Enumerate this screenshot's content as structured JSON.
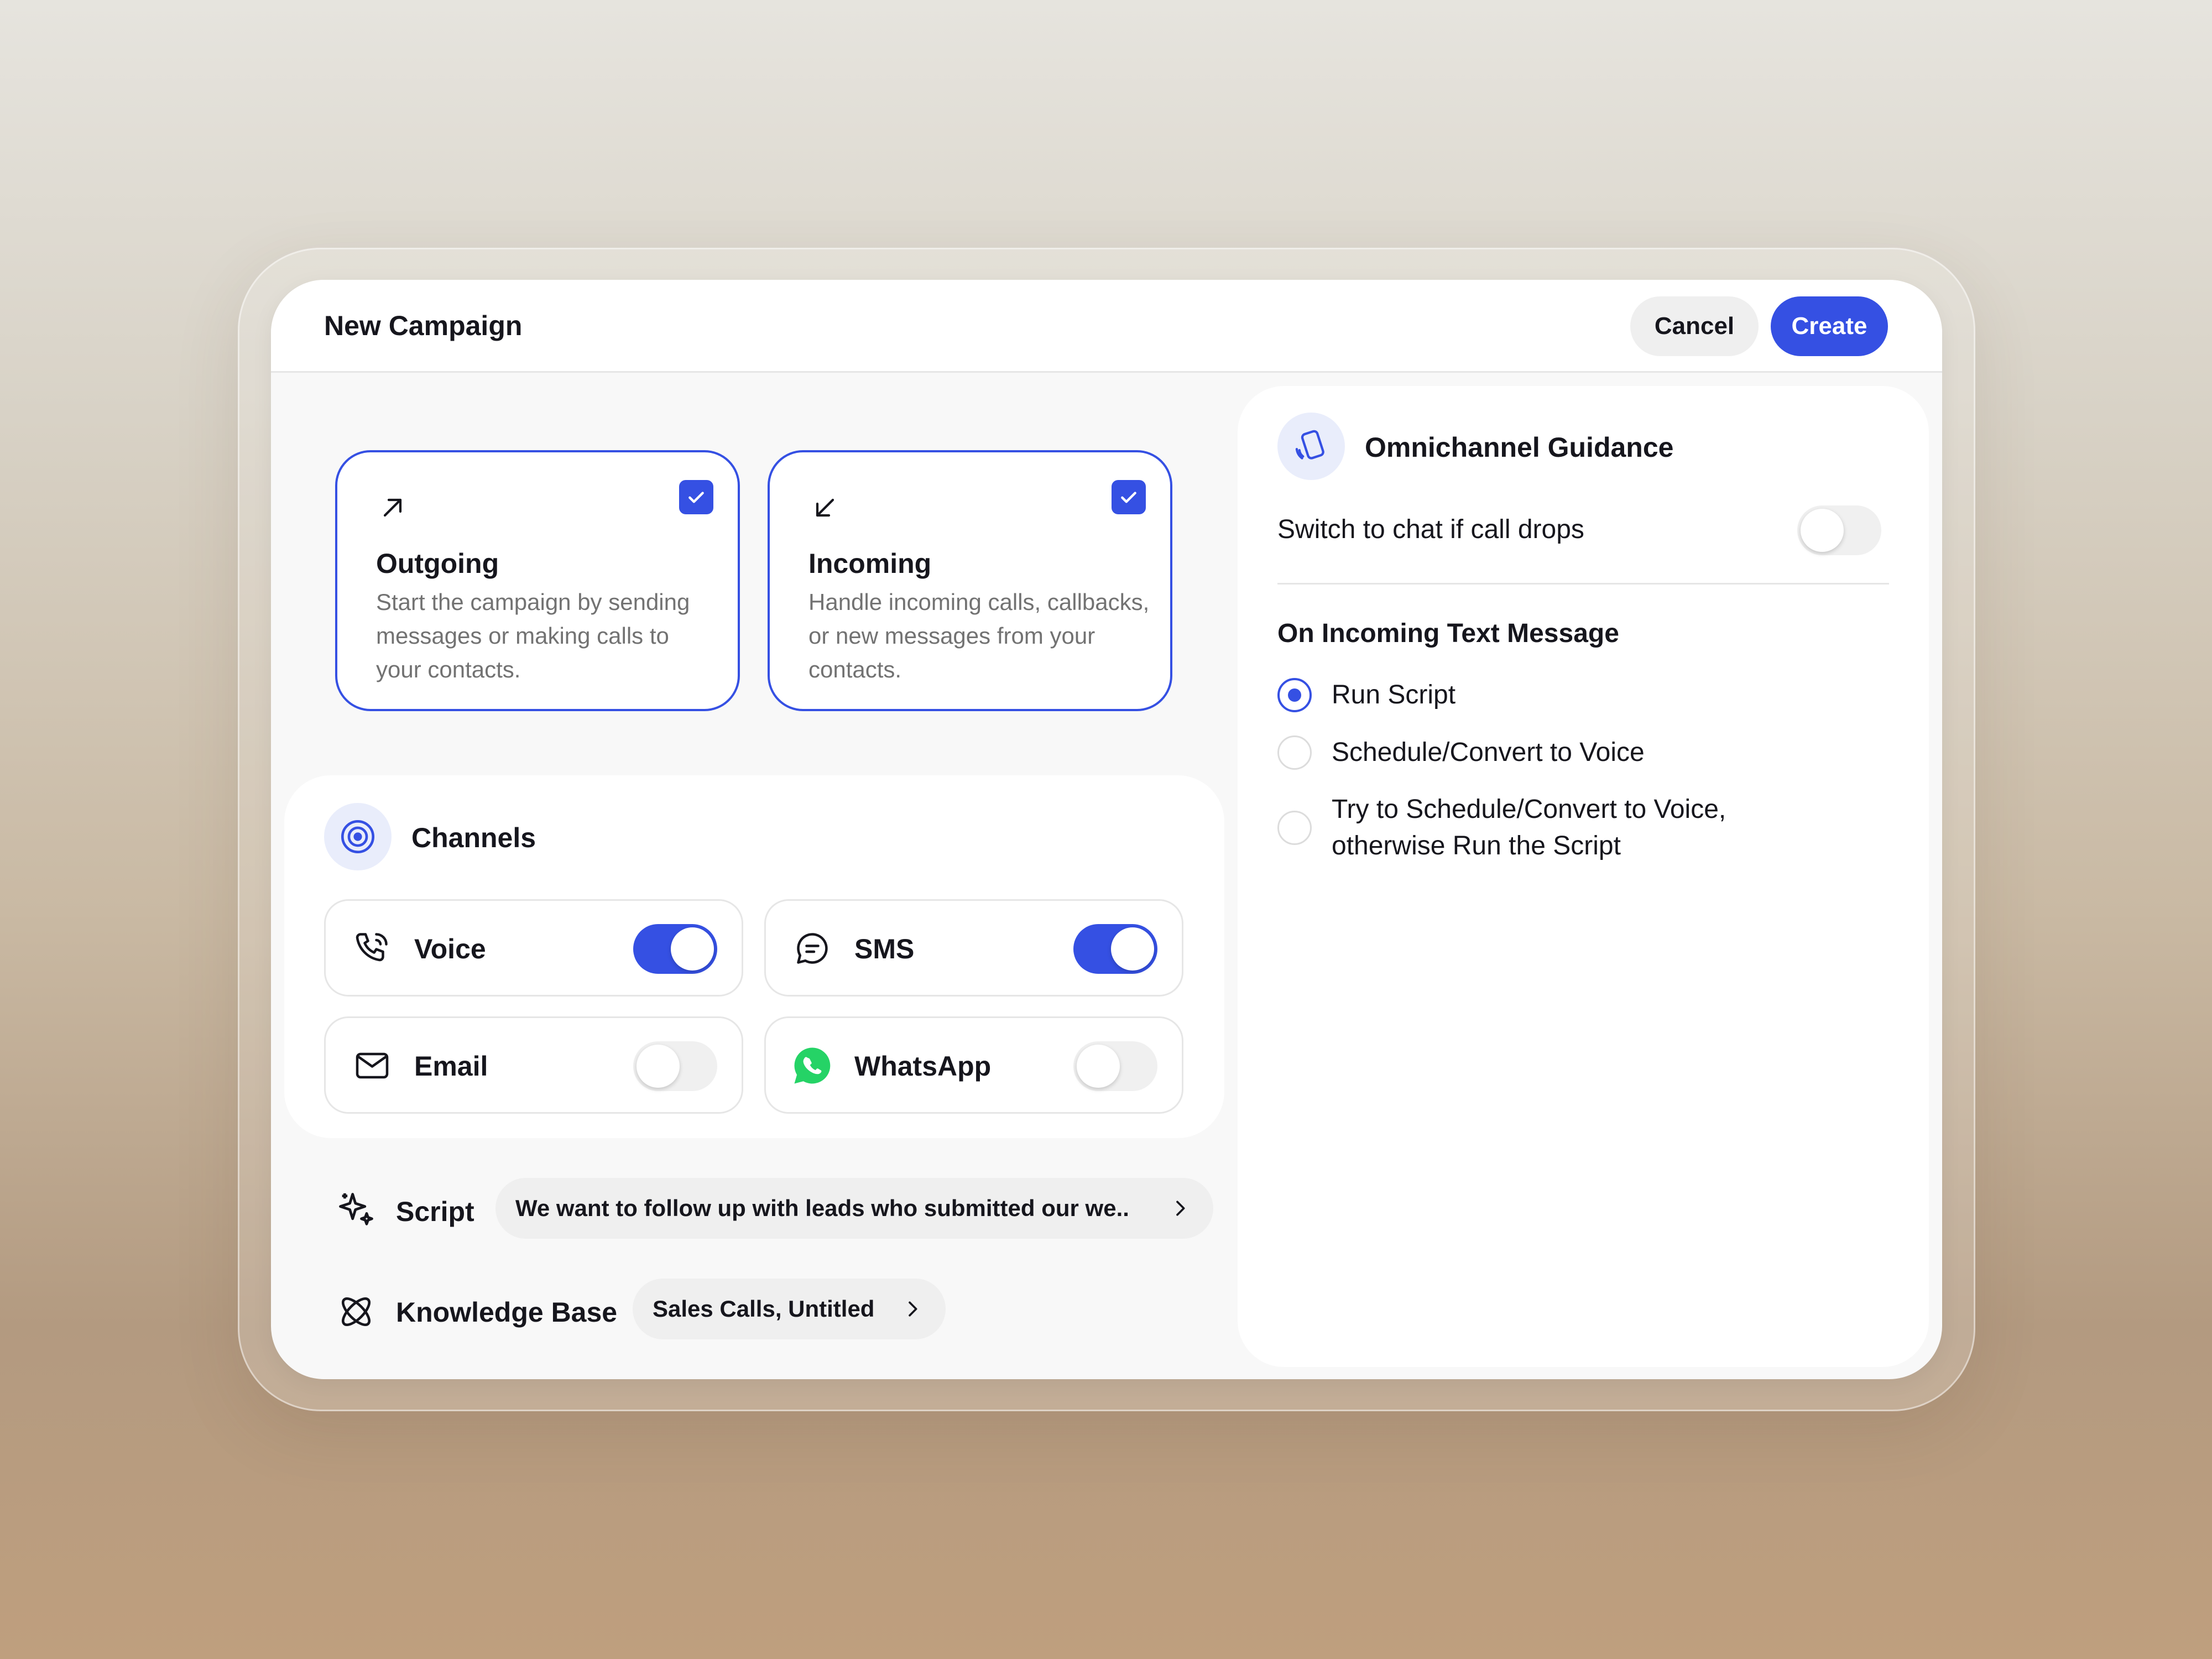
{
  "header": {
    "title": "New Campaign",
    "cancel_label": "Cancel",
    "create_label": "Create"
  },
  "directions": [
    {
      "title": "Outgoing",
      "description": "Start the campaign by sending messages or making calls to your contacts.",
      "checked": true,
      "icon": "arrow-up-right-icon"
    },
    {
      "title": "Incoming",
      "description": "Handle incoming calls, callbacks, or new messages from your contacts.",
      "checked": true,
      "icon": "arrow-down-left-icon"
    }
  ],
  "channels": {
    "title": "Channels",
    "items": [
      {
        "label": "Voice",
        "enabled": true,
        "icon": "phone-icon"
      },
      {
        "label": "SMS",
        "enabled": true,
        "icon": "chat-bubble-icon"
      },
      {
        "label": "Email",
        "enabled": false,
        "icon": "mail-icon"
      },
      {
        "label": "WhatsApp",
        "enabled": false,
        "icon": "whatsapp-icon"
      }
    ]
  },
  "script": {
    "label": "Script",
    "value": "We want to follow up with leads who submitted our we.."
  },
  "knowledge_base": {
    "label": "Knowledge Base",
    "value": "Sales Calls, Untitled"
  },
  "omnichannel": {
    "title": "Omnichannel Guidance",
    "switch_label": "Switch to chat if call drops",
    "switch_enabled": false,
    "section_title": "On Incoming Text Message",
    "options": [
      {
        "label": "Run Script",
        "selected": true
      },
      {
        "label": "Schedule/Convert to Voice",
        "selected": false
      },
      {
        "label": "Try to Schedule/Convert to Voice, otherwise Run the Script",
        "selected": false
      }
    ]
  },
  "colors": {
    "accent": "#3550e3",
    "whatsapp": "#25d366",
    "muted_text": "#727272"
  }
}
